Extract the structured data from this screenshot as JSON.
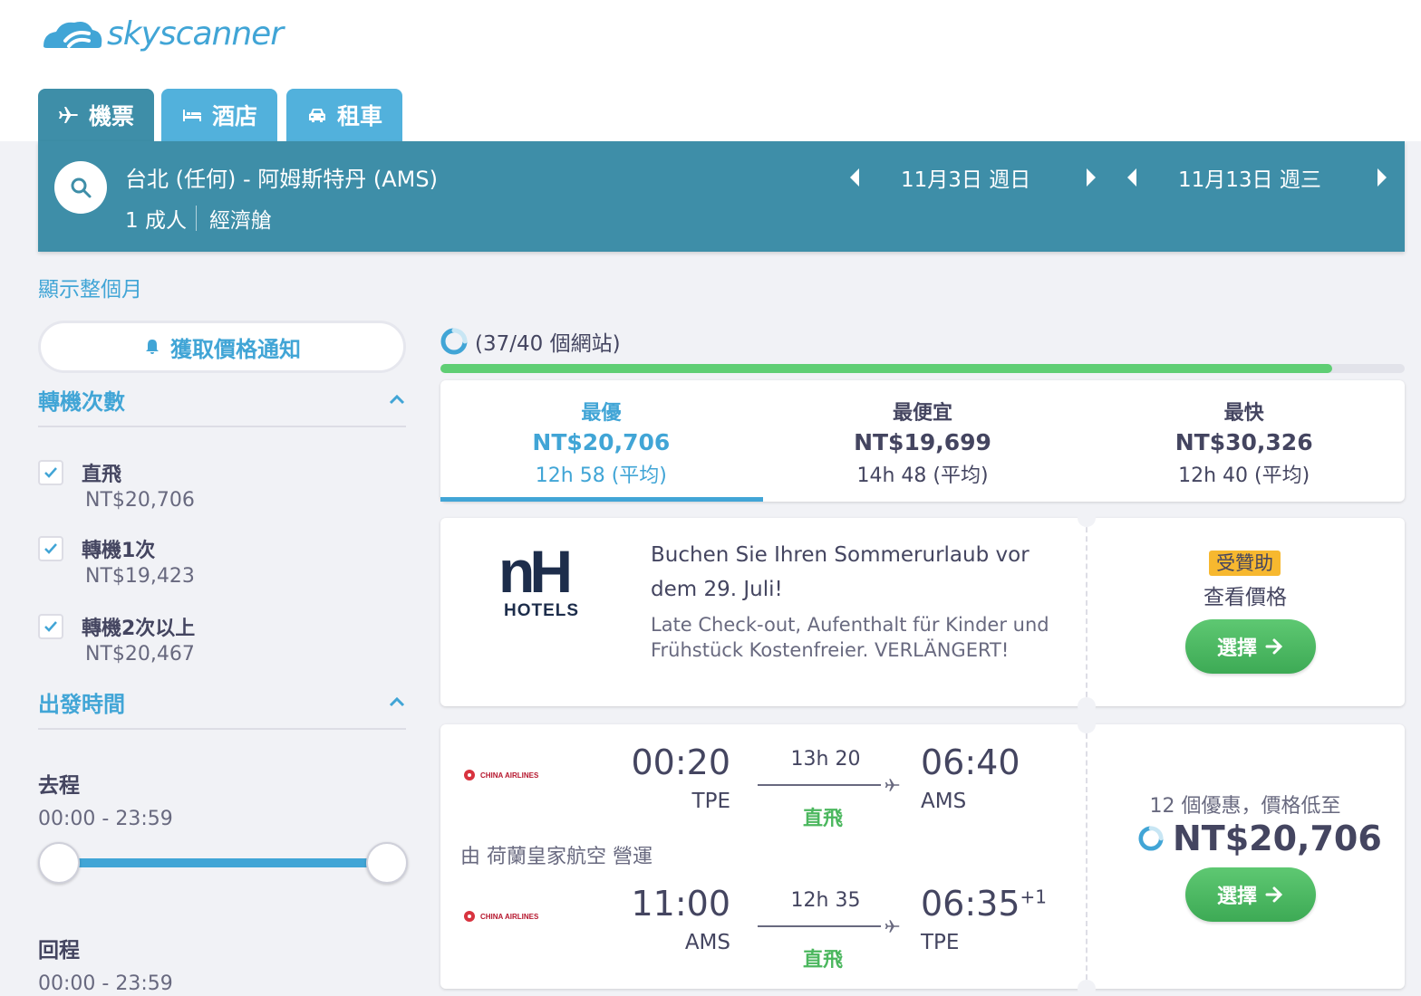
{
  "brand": {
    "name": "skyscanner",
    "color": "#41a5d6"
  },
  "tabs": [
    {
      "label": "機票",
      "icon": "plane-icon",
      "active": true
    },
    {
      "label": "酒店",
      "icon": "bed-icon",
      "active": false
    },
    {
      "label": "租車",
      "icon": "car-icon",
      "active": false
    }
  ],
  "search": {
    "route": "台北 (任何) - 阿姆斯特丹 (AMS)",
    "travellers": "1 成人",
    "cabin": "經濟艙",
    "depart_date": "11月3日 週日",
    "return_date": "11月13日 週三"
  },
  "show_month": "顯示整個月",
  "price_alert": "獲取價格通知",
  "filters": {
    "stops_title": "轉機次數",
    "stops": [
      {
        "label": "直飛",
        "price": "NT$20,706",
        "checked": true
      },
      {
        "label": "轉機1次",
        "price": "NT$19,423",
        "checked": true
      },
      {
        "label": "轉機2次以上",
        "price": "NT$20,467",
        "checked": true
      }
    ],
    "times_title": "出發時間",
    "outbound_label": "去程",
    "outbound_range": "00:00 - 23:59",
    "return_label": "回程",
    "return_range": "00:00 - 23:59"
  },
  "progress": {
    "text": "(37/40 個網站)",
    "fraction": 0.925
  },
  "sort_tabs": [
    {
      "name": "最優",
      "price": "NT$20,706",
      "duration": "12h 58 (平均)",
      "active": true
    },
    {
      "name": "最便宜",
      "price": "NT$19,699",
      "duration": "14h 48 (平均)",
      "active": false
    },
    {
      "name": "最快",
      "price": "NT$30,326",
      "duration": "12h 40 (平均)",
      "active": false
    }
  ],
  "ad": {
    "logo_text": "nH",
    "logo_sub": "HOTELS",
    "title": "Buchen Sie Ihren Sommerurlaub vor dem 29. Juli!",
    "description": "Late Check-out, Aufenthalt für Kinder und Frühstück Kostenfreier. VERLÄNGERT!",
    "sponsored": "受贊助",
    "price_label": "查看價格",
    "select": "選擇"
  },
  "result": {
    "outbound": {
      "airline": "CHINA AIRLINES",
      "dep_time": "00:20",
      "dep_code": "TPE",
      "duration": "13h 20",
      "stops": "直飛",
      "arr_time": "06:40",
      "arr_code": "AMS"
    },
    "operated_by": "由 荷蘭皇家航空 營運",
    "inbound": {
      "airline": "CHINA AIRLINES",
      "dep_time": "11:00",
      "dep_code": "AMS",
      "duration": "12h 35",
      "stops": "直飛",
      "arr_time": "06:35",
      "arr_plus": "+1",
      "arr_code": "TPE"
    },
    "deals": "12 個優惠，價格低至",
    "price": "NT$20,706",
    "select": "選擇"
  }
}
